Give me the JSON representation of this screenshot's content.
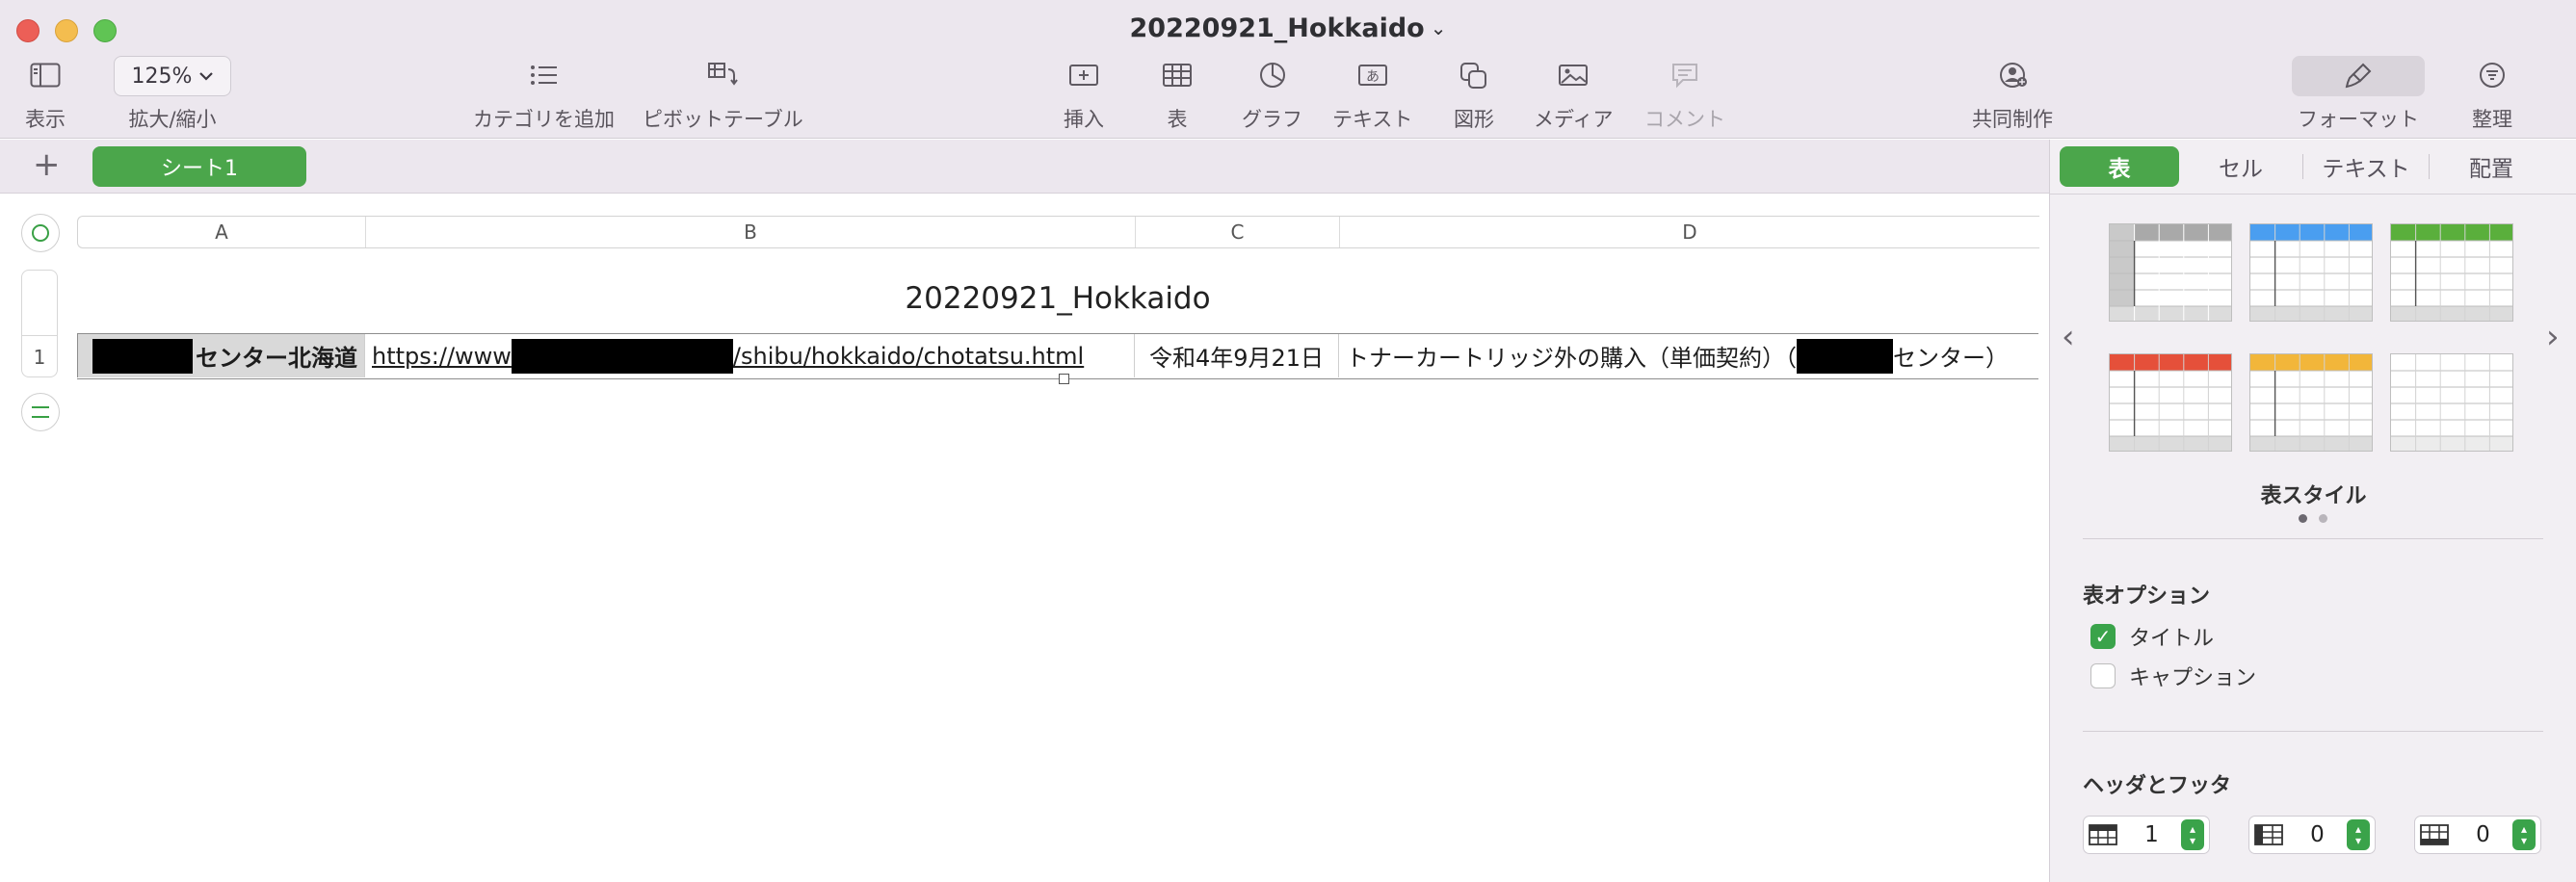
{
  "window": {
    "title": "20220921_Hokkaido",
    "title_chevron": "⌄"
  },
  "toolbar": {
    "view_label": "表示",
    "zoom_value": "125%",
    "zoom_label": "拡大/縮小",
    "add_category_label": "カテゴリを追加",
    "pivot_table_label": "ピボットテーブル",
    "insert_label": "挿入",
    "table_label": "表",
    "chart_label": "グラフ",
    "text_label": "テキスト",
    "shape_label": "図形",
    "media_label": "メディア",
    "comment_label": "コメント",
    "collaborate_label": "共同制作",
    "format_label": "フォーマット",
    "organize_label": "整理"
  },
  "sheets": {
    "add_symbol": "+",
    "tabs": [
      {
        "label": "シート1",
        "active": true
      }
    ]
  },
  "table": {
    "title": "20220921_Hokkaido",
    "column_headers": [
      "A",
      "B",
      "C",
      "D"
    ],
    "rows": [
      {
        "row_number": "1",
        "a_suffix": "センター北海道",
        "b_prefix": "https://www",
        "b_suffix": "/shibu/hokkaido/chotatsu.html",
        "c": "令和4年9月21日",
        "d_prefix": "トナーカートリッジ外の購入（単価契約）（",
        "d_suffix": "センター）"
      }
    ]
  },
  "inspector": {
    "tabs": [
      {
        "label": "表",
        "active": true
      },
      {
        "label": "セル",
        "active": false
      },
      {
        "label": "テキスト",
        "active": false
      },
      {
        "label": "配置",
        "active": false
      }
    ],
    "table_styles_label": "表スタイル",
    "table_options_title": "表オプション",
    "title_checkbox_label": "タイトル",
    "title_checked": true,
    "caption_checkbox_label": "キャプション",
    "caption_checked": false,
    "headers_footer_title": "ヘッダとフッタ",
    "header_rows": "1",
    "header_columns": "0",
    "footer_rows": "0",
    "style_colors": [
      "#a9a9a9",
      "#4a9ef0",
      "#5aaf3c",
      "#e5503a",
      "#f2b63a",
      "#e8e8e8"
    ]
  },
  "colors": {
    "accent_green": "#4ba64b",
    "toolbar_bg": "#ece7ee"
  }
}
